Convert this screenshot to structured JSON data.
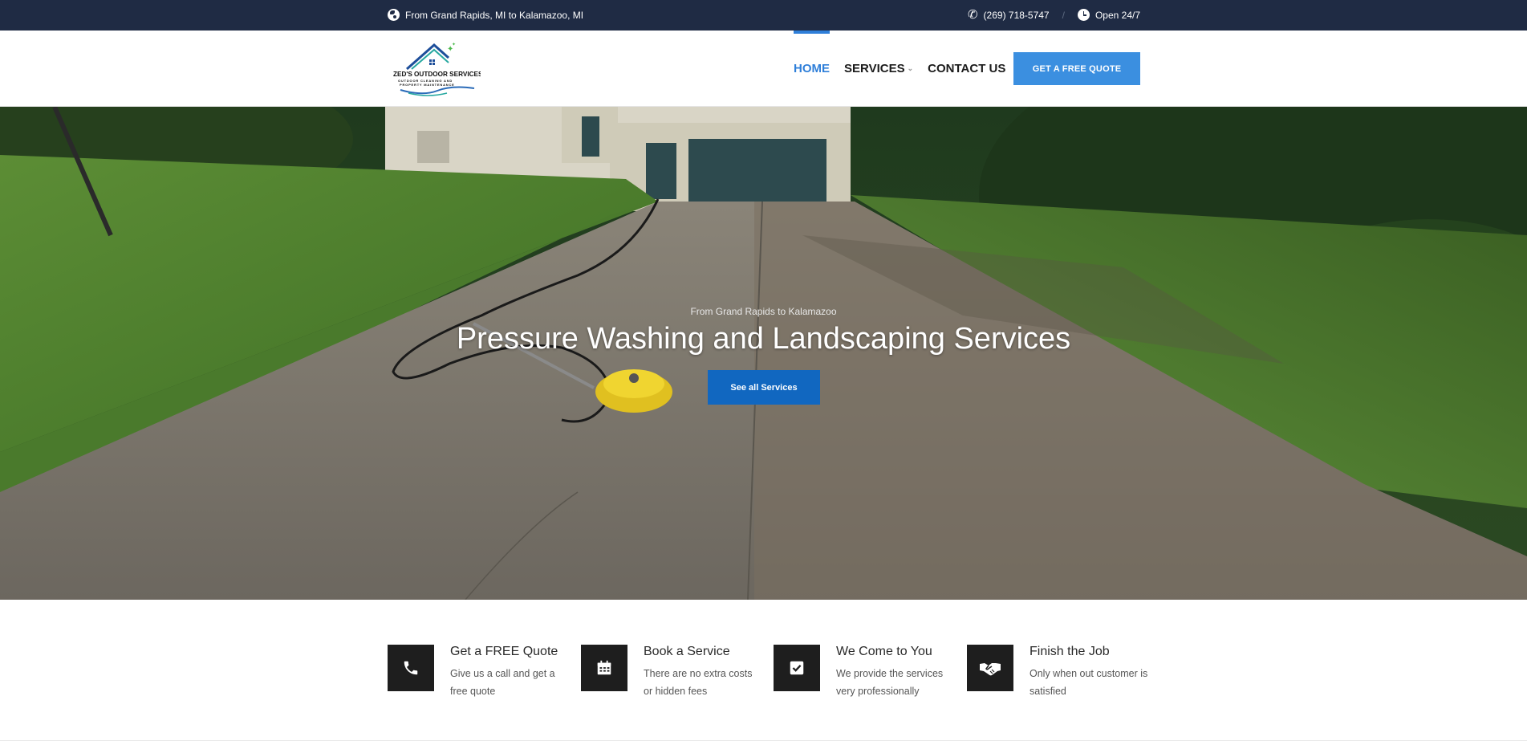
{
  "topbar": {
    "location": "From Grand Rapids, MI to Kalamazoo, MI",
    "phone": "(269) 718-5747",
    "hours": "Open 24/7"
  },
  "header": {
    "logo_name": "ZED'S OUTDOOR SERVICES",
    "logo_tagline": "OUTDOOR CLEANING AND PROPERTY MAINTENANCE",
    "nav": {
      "home": "HOME",
      "services": "SERVICES",
      "contact": "CONTACT US"
    },
    "quote_button": "GET A FREE QUOTE",
    "accent_color": "#2f7fd9"
  },
  "hero": {
    "subtitle": "From Grand Rapids to Kalamazoo",
    "title": "Pressure Washing and Landscaping Services",
    "button": "See all Services"
  },
  "features": [
    {
      "title": "Get a FREE Quote",
      "desc": "Give us a call and get a free quote",
      "icon": "phone-icon"
    },
    {
      "title": "Book a Service",
      "desc": "There are no extra costs or hidden fees",
      "icon": "calendar-icon"
    },
    {
      "title": "We Come to You",
      "desc": "We provide the services very professionally",
      "icon": "check-square-icon"
    },
    {
      "title": "Finish the Job",
      "desc": "Only when out customer is satisfied",
      "icon": "handshake-icon"
    }
  ]
}
